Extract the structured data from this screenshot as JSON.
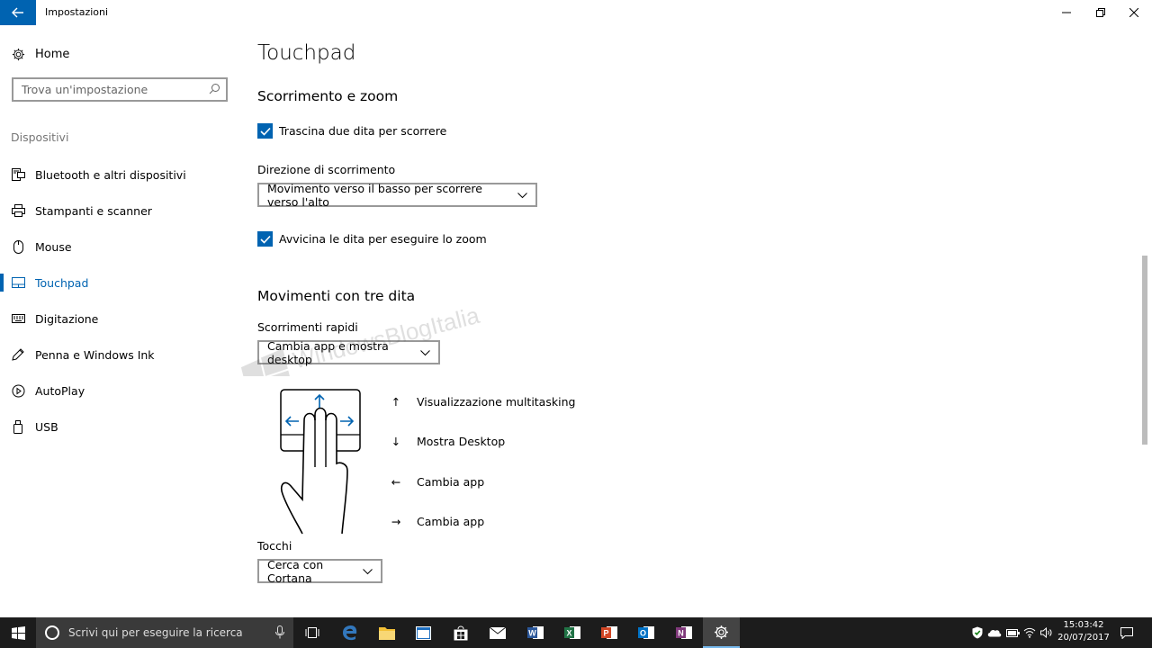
{
  "window": {
    "title": "Impostazioni",
    "controls": {
      "minimize": "—",
      "maximize": "☐",
      "close": "✕"
    }
  },
  "sidebar": {
    "home_label": "Home",
    "search_placeholder": "Trova un'impostazione",
    "section_label": "Dispositivi",
    "items": [
      {
        "label": "Bluetooth e altri dispositivi",
        "icon": "bluetooth-device-icon",
        "active": false
      },
      {
        "label": "Stampanti e scanner",
        "icon": "printer-icon",
        "active": false
      },
      {
        "label": "Mouse",
        "icon": "mouse-icon",
        "active": false
      },
      {
        "label": "Touchpad",
        "icon": "touchpad-icon",
        "active": true
      },
      {
        "label": "Digitazione",
        "icon": "keyboard-icon",
        "active": false
      },
      {
        "label": "Penna e Windows Ink",
        "icon": "pen-icon",
        "active": false
      },
      {
        "label": "AutoPlay",
        "icon": "autoplay-icon",
        "active": false
      },
      {
        "label": "USB",
        "icon": "usb-icon",
        "active": false
      }
    ]
  },
  "main": {
    "page_title": "Touchpad",
    "scroll_zoom": {
      "heading": "Scorrimento e zoom",
      "two_finger_scroll": {
        "label": "Trascina due dita per scorrere",
        "checked": true
      },
      "scroll_direction_label": "Direzione di scorrimento",
      "scroll_direction_value": "Movimento verso il basso per scorrere verso l'alto",
      "pinch_zoom": {
        "label": "Avvicina le dita per eseguire lo zoom",
        "checked": true
      }
    },
    "three_finger": {
      "heading": "Movimenti con tre dita",
      "swipes_label": "Scorrimenti rapidi",
      "swipes_value": "Cambia app e mostra desktop",
      "gestures": [
        {
          "arrow": "↑",
          "icon": "arrow-up-icon",
          "label": "Visualizzazione multitasking"
        },
        {
          "arrow": "↓",
          "icon": "arrow-down-icon",
          "label": "Mostra Desktop"
        },
        {
          "arrow": "←",
          "icon": "arrow-left-icon",
          "label": "Cambia app"
        },
        {
          "arrow": "→",
          "icon": "arrow-right-icon",
          "label": "Cambia app"
        }
      ],
      "taps_label": "Tocchi",
      "taps_value": "Cerca con Cortana"
    },
    "watermark_text": "WindowsBlogItalia"
  },
  "taskbar": {
    "search_placeholder": "Scrivi qui per eseguire la ricerca",
    "apps": [
      "task-view",
      "edge",
      "file-explorer",
      "app-window",
      "store",
      "mail",
      "word",
      "excel",
      "powerpoint",
      "outlook",
      "onenote",
      "settings"
    ],
    "time": "15:03:42",
    "date": "20/07/2017"
  },
  "colors": {
    "accent": "#0063b1",
    "taskbar": "#1c1c1c",
    "word": "#2b579a",
    "excel": "#217346",
    "powerpoint": "#d24726",
    "outlook": "#0072c6",
    "onenote": "#80397b",
    "explorer": "#f3c037"
  }
}
